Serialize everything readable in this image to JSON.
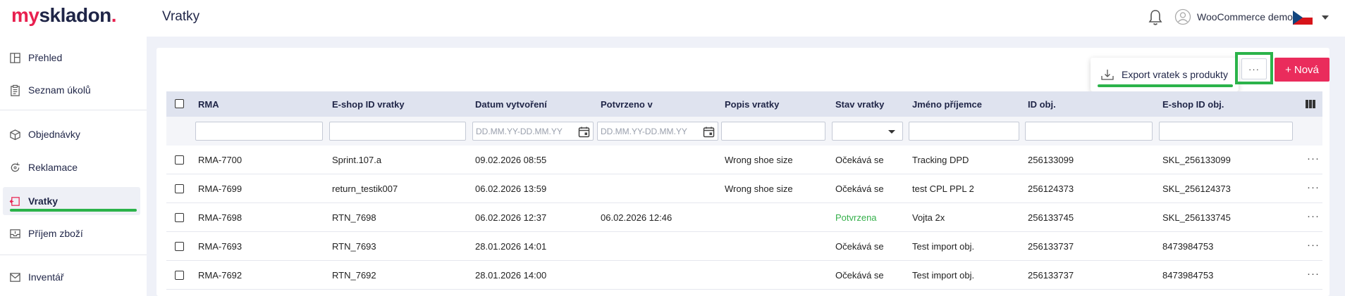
{
  "app": {
    "logo_my": "my",
    "logo_rest": "skladon",
    "logo_dot": ".",
    "page_title": "Vratky"
  },
  "user": {
    "name": "WooCommerce demo"
  },
  "sidebar": {
    "items": [
      {
        "label": "Přehled",
        "icon": "dashboard-icon"
      },
      {
        "label": "Seznam úkolů",
        "icon": "clipboard-icon"
      },
      {
        "label": "Objednávky",
        "icon": "box-icon"
      },
      {
        "label": "Reklamace",
        "icon": "refresh-icon"
      },
      {
        "label": "Vratky",
        "icon": "return-icon",
        "active": true
      },
      {
        "label": "Příjem zboží",
        "icon": "inbox-icon"
      },
      {
        "label": "Inventář",
        "icon": "inventory-icon"
      }
    ]
  },
  "toolbar": {
    "export_label": "Export vratek s produkty",
    "more_label": "···",
    "new_label": "Nová",
    "new_plus": "+"
  },
  "table": {
    "columns": [
      "RMA",
      "E-shop ID vratky",
      "Datum vytvoření",
      "Potvrzeno v",
      "Popis vratky",
      "Stav vratky",
      "Jméno příjemce",
      "ID obj.",
      "E-shop ID obj."
    ],
    "date_placeholder": "DD.MM.YY-DD.MM.YY",
    "rows": [
      {
        "rma": "RMA-7700",
        "eshop_id": "Sprint.107.a",
        "created": "09.02.2026 08:55",
        "confirmed": "",
        "desc": "Wrong shoe size",
        "status": "Očekává se",
        "recipient": "Tracking DPD",
        "order_id": "256133099",
        "eshop_order_id": "SKL_256133099"
      },
      {
        "rma": "RMA-7699",
        "eshop_id": "return_testik007",
        "created": "06.02.2026 13:59",
        "confirmed": "",
        "desc": "Wrong shoe size",
        "status": "Očekává se",
        "recipient": "test CPL PPL 2",
        "order_id": "256124373",
        "eshop_order_id": "SKL_256124373"
      },
      {
        "rma": "RMA-7698",
        "eshop_id": "RTN_7698",
        "created": "06.02.2026 12:37",
        "confirmed": "06.02.2026 12:46",
        "desc": "",
        "status": "Potvrzena",
        "recipient": "Vojta 2x",
        "order_id": "256133745",
        "eshop_order_id": "SKL_256133745"
      },
      {
        "rma": "RMA-7693",
        "eshop_id": "RTN_7693",
        "created": "28.01.2026 14:01",
        "confirmed": "",
        "desc": "",
        "status": "Očekává se",
        "recipient": "Test import obj.",
        "order_id": "256133737",
        "eshop_order_id": "8473984753"
      },
      {
        "rma": "RMA-7692",
        "eshop_id": "RTN_7692",
        "created": "28.01.2026 14:00",
        "confirmed": "",
        "desc": "",
        "status": "Očekává se",
        "recipient": "Test import obj.",
        "order_id": "256133737",
        "eshop_order_id": "8473984753"
      }
    ],
    "row_more_label": "···"
  },
  "colors": {
    "brand_red": "#e8204f",
    "brand_navy": "#1f2547",
    "highlight_green": "#2bb34a",
    "status_confirmed": "#35b04b",
    "new_button": "#ea2c5c"
  }
}
